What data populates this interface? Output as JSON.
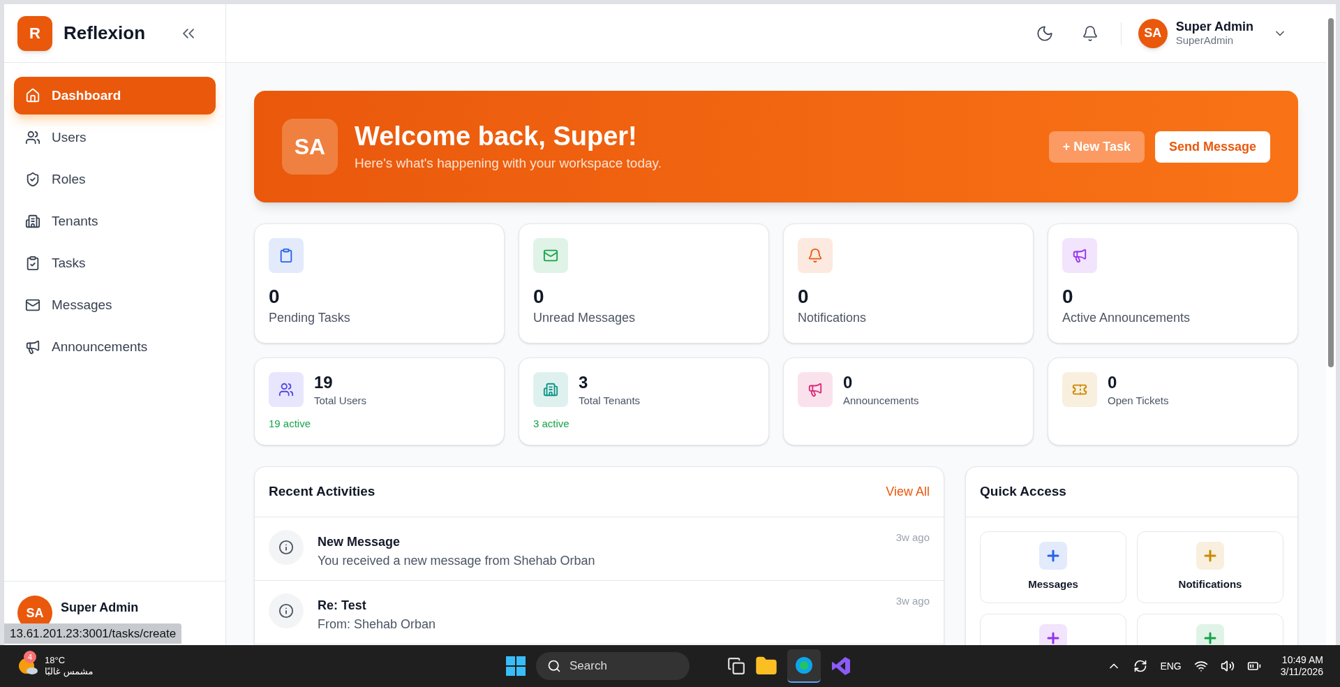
{
  "sidebar": {
    "logo_letter": "R",
    "brand": "Reflexion",
    "items": [
      {
        "label": "Dashboard",
        "kind": "home",
        "selected": true
      },
      {
        "label": "Users",
        "kind": "users",
        "selected": false
      },
      {
        "label": "Roles",
        "kind": "shield",
        "selected": false
      },
      {
        "label": "Tenants",
        "kind": "building",
        "selected": false
      },
      {
        "label": "Tasks",
        "kind": "clipboard-check",
        "selected": false
      },
      {
        "label": "Messages",
        "kind": "mail",
        "selected": false
      },
      {
        "label": "Announcements",
        "kind": "megaphone",
        "selected": false
      }
    ],
    "user": {
      "initials": "SA",
      "name": "Super Admin"
    }
  },
  "header": {
    "user": {
      "initials": "SA",
      "name": "Super Admin",
      "role": "SuperAdmin"
    }
  },
  "banner": {
    "initials": "SA",
    "title": "Welcome back, Super!",
    "subtitle": "Here's what's happening with your workspace today.",
    "buttons": [
      {
        "label": "+ New Task",
        "kind": "ghost"
      },
      {
        "label": "Send Message",
        "kind": "solid"
      }
    ]
  },
  "stats": [
    {
      "value": "0",
      "label": "Pending Tasks",
      "kind": "clipboard",
      "color": "#2563eb"
    },
    {
      "value": "0",
      "label": "Unread Messages",
      "kind": "mail",
      "color": "#16a34a"
    },
    {
      "value": "0",
      "label": "Notifications",
      "kind": "bell",
      "color": "#ea580c"
    },
    {
      "value": "0",
      "label": "Active Announcements",
      "kind": "megaphone",
      "color": "#9333ea"
    }
  ],
  "summary": [
    {
      "value": "19",
      "label": "Total Users",
      "note": "19 active",
      "kind": "users",
      "color": "#4f46e5"
    },
    {
      "value": "3",
      "label": "Total Tenants",
      "note": "3 active",
      "kind": "building",
      "color": "#0d9488"
    },
    {
      "value": "0",
      "label": "Announcements",
      "kind": "megaphone",
      "color": "#db2777"
    },
    {
      "value": "0",
      "label": "Open Tickets",
      "kind": "ticket",
      "color": "#ca8a04"
    }
  ],
  "activities": {
    "title": "Recent Activities",
    "link": "View All",
    "items": [
      {
        "title": "New Message",
        "text": "You received a new message from Shehab Orban",
        "time": "3w ago"
      },
      {
        "title": "Re: Test",
        "text": "From: Shehab Orban",
        "time": "3w ago"
      }
    ]
  },
  "quick_access": {
    "title": "Quick Access",
    "items": [
      {
        "label": "Messages",
        "color": "#2563eb"
      },
      {
        "label": "Notifications",
        "color": "#ca8a04"
      },
      {
        "color": "#9333ea"
      },
      {
        "color": "#16a34a"
      }
    ]
  },
  "status_url": "13.61.201.23:3001/tasks/create",
  "taskbar": {
    "weather_badge": "4",
    "temperature": "18°C",
    "weather_text": "مشمس غالبًا",
    "search": "Search",
    "language": "ENG",
    "time": "10:49 AM",
    "date": "3/11/2026"
  }
}
